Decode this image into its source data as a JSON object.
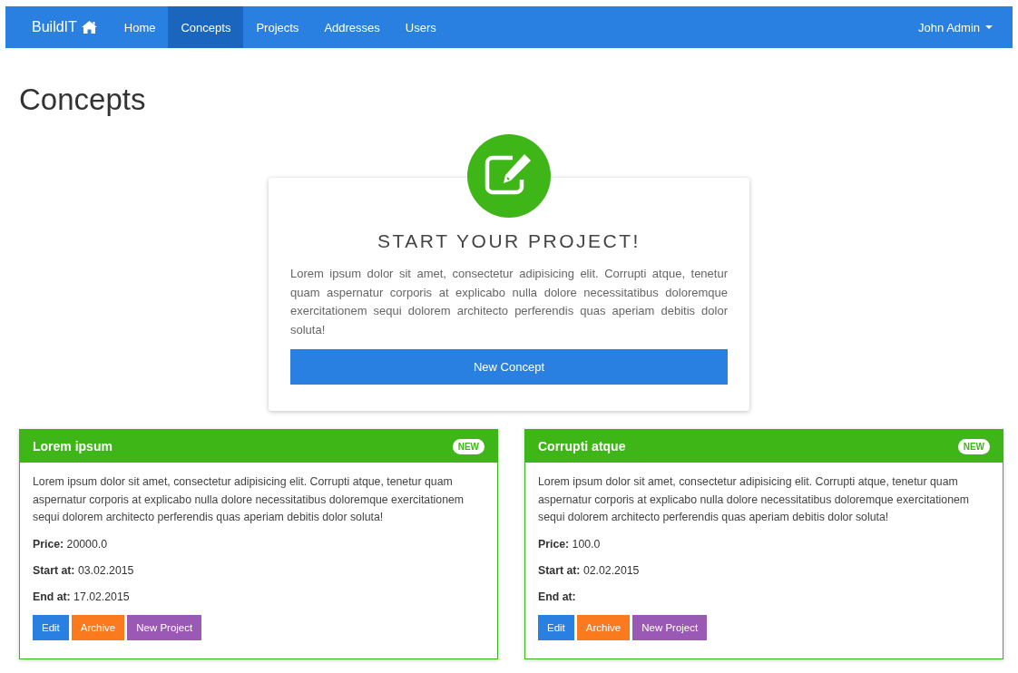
{
  "navbar": {
    "brand": "BuildIT",
    "items": [
      {
        "label": "Home",
        "selected": false
      },
      {
        "label": "Concepts",
        "selected": true
      },
      {
        "label": "Projects",
        "selected": false
      },
      {
        "label": "Addresses",
        "selected": false
      },
      {
        "label": "Users",
        "selected": false
      }
    ],
    "user": "John Admin"
  },
  "page_title": "Concepts",
  "start_card": {
    "title": "START YOUR PROJECT!",
    "text": "Lorem ipsum dolor sit amet, consectetur adipisicing elit. Corrupti atque, tenetur quam aspernatur corporis at explicabo nulla dolore necessitatibus doloremque exercitationem sequi dolorem architecto perferendis quas aperiam debitis dolor soluta!",
    "button": "New Concept"
  },
  "concepts": [
    {
      "title": "Lorem ipsum",
      "badge": "NEW",
      "text": "Lorem ipsum dolor sit amet, consectetur adipisicing elit. Corrupti atque, tenetur quam aspernatur corporis at explicabo nulla dolore necessitatibus doloremque exercitationem sequi dolorem architecto perferendis quas aperiam debitis dolor soluta!",
      "fields": [
        {
          "label": "Price:",
          "value": "20000.0"
        },
        {
          "label": "Start at:",
          "value": "03.02.2015"
        },
        {
          "label": "End at:",
          "value": "17.02.2015"
        }
      ],
      "buttons": [
        {
          "label": "Edit",
          "kind": "edit"
        },
        {
          "label": "Archive",
          "kind": "archive"
        },
        {
          "label": "New Project",
          "kind": "project"
        }
      ]
    },
    {
      "title": "Corrupti atque",
      "badge": "NEW",
      "text": "Lorem ipsum dolor sit amet, consectetur adipisicing elit. Corrupti atque, tenetur quam aspernatur corporis at explicabo nulla dolore necessitatibus doloremque exercitationem sequi dolorem architecto perferendis quas aperiam debitis dolor soluta!",
      "fields": [
        {
          "label": "Price:",
          "value": "100.0"
        },
        {
          "label": "Start at:",
          "value": "02.02.2015"
        },
        {
          "label": "End at:"
        }
      ],
      "buttons": [
        {
          "label": "Edit",
          "kind": "edit"
        },
        {
          "label": "Archive",
          "kind": "archive"
        },
        {
          "label": "New Project",
          "kind": "project"
        }
      ]
    }
  ]
}
